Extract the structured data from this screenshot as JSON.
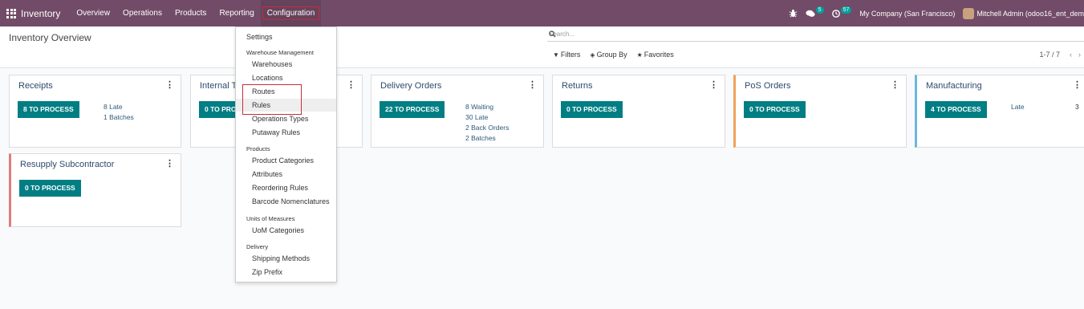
{
  "navbar": {
    "app_name": "Inventory",
    "menu": [
      "Overview",
      "Operations",
      "Products",
      "Reporting",
      "Configuration"
    ],
    "notifications_count": "5",
    "activities_count": "57",
    "company": "My Company (San Francisco)",
    "user": "Mitchell Admin (odoo16_ent_dem"
  },
  "control_panel": {
    "title": "Inventory Overview",
    "search_placeholder": "Search...",
    "filters_label": "Filters",
    "groupby_label": "Group By",
    "favorites_label": "Favorites",
    "pager": "1-7 / 7"
  },
  "cards": {
    "receipts": {
      "title": "Receipts",
      "button": "8 TO PROCESS",
      "stats": [
        "8 Late",
        "1 Batches"
      ]
    },
    "internal": {
      "title": "Internal T",
      "button": "0 TO PROCESS"
    },
    "delivery": {
      "title": "Delivery Orders",
      "button": "22 TO PROCESS",
      "stats": [
        "8 Waiting",
        "30 Late",
        "2 Back Orders",
        "2 Batches"
      ]
    },
    "returns": {
      "title": "Returns",
      "button": "0 TO PROCESS"
    },
    "pos": {
      "title": "PoS Orders",
      "button": "0 TO PROCESS"
    },
    "manufacturing": {
      "title": "Manufacturing",
      "button": "4 TO PROCESS",
      "late_label": "Late",
      "late_count": "3"
    },
    "resupply": {
      "title": "Resupply Subcontractor",
      "button": "0 TO PROCESS"
    }
  },
  "dropdown": {
    "settings": "Settings",
    "warehouse_header": "Warehouse Management",
    "warehouse_items": [
      "Warehouses",
      "Locations",
      "Routes",
      "Rules",
      "Operations Types",
      "Putaway Rules"
    ],
    "products_header": "Products",
    "products_items": [
      "Product Categories",
      "Attributes",
      "Reordering Rules",
      "Barcode Nomenclatures"
    ],
    "uom_header": "Units of Measures",
    "uom_items": [
      "UoM Categories"
    ],
    "delivery_header": "Delivery",
    "delivery_items": [
      "Shipping Methods",
      "Zip Prefix"
    ]
  },
  "colors": {
    "navbar": "#714b67",
    "button": "#017e84",
    "highlight": "#c72d3a"
  }
}
